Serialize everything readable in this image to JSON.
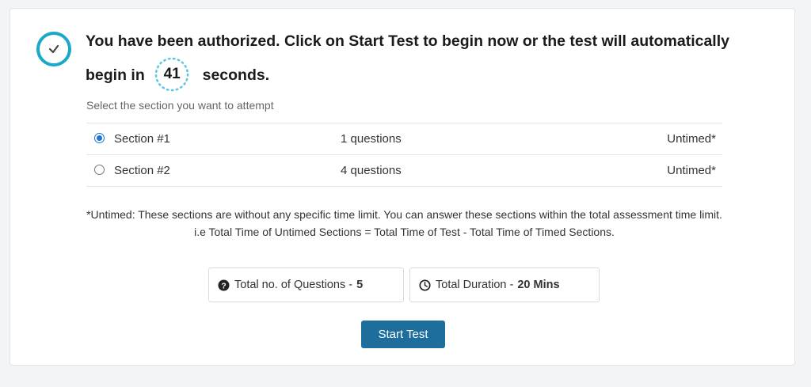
{
  "header": {
    "message_part1": "You have been authorized. Click on Start Test to begin now or the test will automatically begin in",
    "countdown": "41",
    "message_part2": "seconds."
  },
  "sections": {
    "prompt": "Select the section you want to attempt",
    "items": [
      {
        "name": "Section #1",
        "questions": "1 questions",
        "timing": "Untimed*",
        "selected": true
      },
      {
        "name": "Section #2",
        "questions": "4 questions",
        "timing": "Untimed*",
        "selected": false
      }
    ]
  },
  "note": {
    "line1": "*Untimed: These sections are without any specific time limit. You can answer these sections within the total assessment time limit.",
    "line2": "i.e Total Time of Untimed Sections = Total Time of Test - Total Time of Timed Sections."
  },
  "stats": {
    "questions_label": "Total no. of Questions -",
    "questions_value": "5",
    "questions_icon": "question-circle-icon",
    "duration_label": "Total Duration -",
    "duration_value": "20 Mins",
    "duration_icon": "clock-icon"
  },
  "actions": {
    "start_label": "Start Test"
  },
  "colors": {
    "accent": "#19a9c8",
    "button": "#1d6e9c",
    "radio_selected": "#1e74d6"
  }
}
